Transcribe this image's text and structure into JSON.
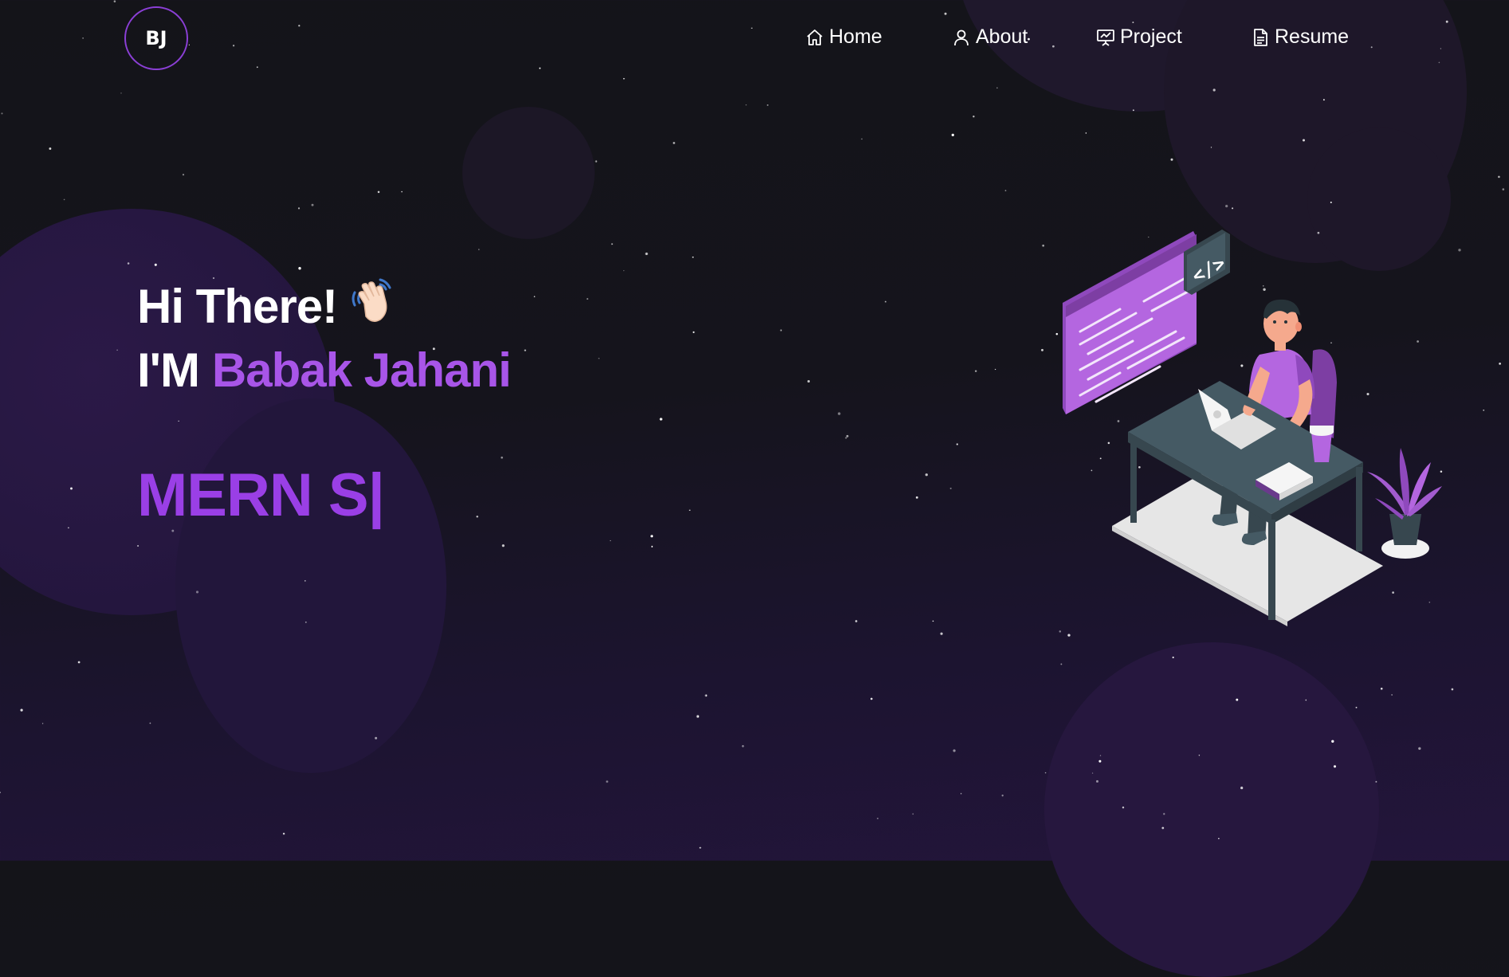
{
  "logo": {
    "text": "BJ"
  },
  "nav": {
    "items": [
      {
        "label": "Home",
        "icon": "home-icon"
      },
      {
        "label": "About",
        "icon": "user-icon"
      },
      {
        "label": "Project",
        "icon": "presentation-icon"
      },
      {
        "label": "Resume",
        "icon": "document-icon"
      }
    ]
  },
  "hero": {
    "greeting": "Hi There!",
    "wave_icon": "waving-hand-icon",
    "intro_prefix": "I'M",
    "name": "Babak Jahani",
    "typed_text": "MERN S|"
  },
  "illustration": {
    "code_tag": "</>"
  },
  "colors": {
    "accent": "#a855e8",
    "typed": "#9a3fe6",
    "logo_border": "#8b3fd6",
    "background": "#141419"
  }
}
